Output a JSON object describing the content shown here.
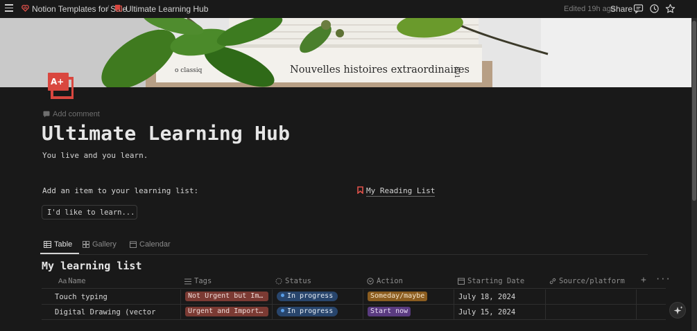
{
  "topbar": {
    "breadcrumb_parent": "Notion Templates for Sale",
    "breadcrumb_separator": "/",
    "breadcrumb_current": "Ultimate Learning Hub",
    "edited": "Edited 19h ago",
    "share": "Share"
  },
  "cover": {
    "book_title": "Nouvelles histoires extraordinaires",
    "book_spine": "801",
    "book_partial": "o classiq"
  },
  "page": {
    "icon_text": "A+",
    "add_comment": "Add comment",
    "title": "Ultimate Learning Hub",
    "subtitle": "You live and you learn.",
    "add_item_label": "Add an item to your learning list:",
    "reading_list_link": "My Reading List",
    "learn_button": "I'd like to learn..."
  },
  "views": {
    "tabs": [
      {
        "label": "Table",
        "icon": "table-icon",
        "active": true
      },
      {
        "label": "Gallery",
        "icon": "gallery-icon",
        "active": false
      },
      {
        "label": "Calendar",
        "icon": "calendar-icon",
        "active": false
      }
    ]
  },
  "database": {
    "title": "My learning list",
    "name_prefix": "Aa",
    "columns": [
      "Name",
      "Tags",
      "Status",
      "Action",
      "Starting Date",
      "Source/platform"
    ],
    "rows": [
      {
        "name": "Touch typing",
        "tag": "Not Urgent but Im…",
        "status": "In progress",
        "action": "Someday/maybe",
        "date": "July 18, 2024",
        "source": ""
      },
      {
        "name": "Digital Drawing (vector",
        "tag": "Urgent and Import…",
        "status": "In progress",
        "action": "Start now",
        "date": "July 15, 2024",
        "source": ""
      }
    ]
  },
  "colors": {
    "background": "#191919",
    "tag_red": "#7b3a33",
    "status_blue": "#28456c",
    "action_someday": "#8b5d20",
    "action_start": "#5a3b80",
    "page_icon_red": "#d9473f"
  }
}
